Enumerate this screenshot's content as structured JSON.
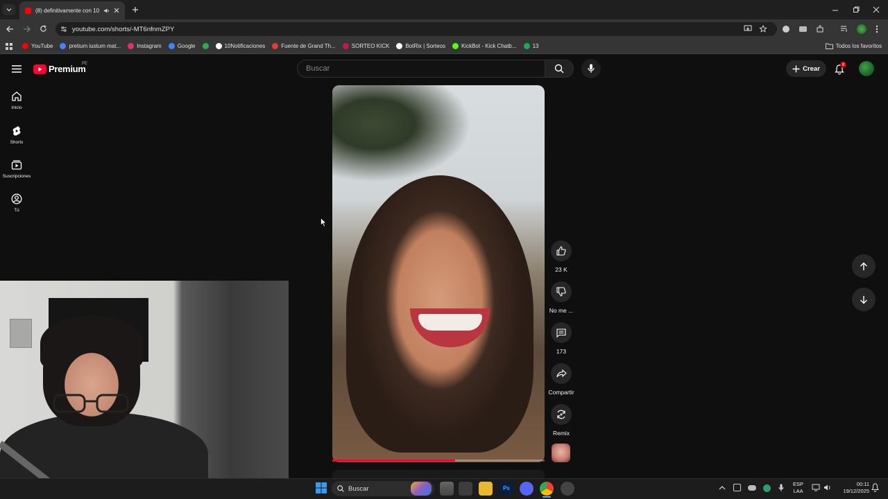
{
  "browser": {
    "tab_title": "(8) definitivamente con 10",
    "url": "youtube.com/shorts/-MT6nfnmZPY",
    "bookmarks": [
      {
        "label": "YouTube",
        "color": "#ff0000"
      },
      {
        "label": "pretium iustum mat...",
        "color": "#4285f4"
      },
      {
        "label": "Instagram",
        "color": "#e1306c"
      },
      {
        "label": "Google",
        "color": "#4285f4"
      },
      {
        "label": "",
        "color": "#34a853"
      },
      {
        "label": "10Notificaciones",
        "color": "#ffffff"
      },
      {
        "label": "Fuente de Grand Th...",
        "color": "#e53935"
      },
      {
        "label": "SORTEO KICK",
        "color": "#c2185b"
      },
      {
        "label": "BotRix | Sorteos",
        "color": "#ffffff"
      },
      {
        "label": "KickBot - Kick Chatb...",
        "color": "#53fc18"
      },
      {
        "label": "13",
        "color": "#1fa855"
      }
    ],
    "all_bookmarks_label": "Todos los favoritos"
  },
  "youtube": {
    "logo_text": "Premium",
    "region_badge": "PE",
    "search_placeholder": "Buscar",
    "create_label": "Crear",
    "notification_count": "8",
    "sidebar": [
      {
        "label": "Inicio",
        "icon": "home-icon"
      },
      {
        "label": "Shorts",
        "icon": "shorts-icon"
      },
      {
        "label": "Suscripciones",
        "icon": "subscriptions-icon"
      },
      {
        "label": "Tú",
        "icon": "you-icon"
      }
    ],
    "actions": {
      "likes": "23 K",
      "dislike_label": "No me ...",
      "comments": "173",
      "share_label": "Compartir",
      "remix_label": "Remix"
    },
    "progress": 0.58,
    "accent": "#ff0033"
  },
  "taskbar": {
    "search_label": "Buscar",
    "lang_top": "ESP",
    "lang_bottom": "LAA",
    "time": "00:11",
    "date": "19/12/2025"
  }
}
